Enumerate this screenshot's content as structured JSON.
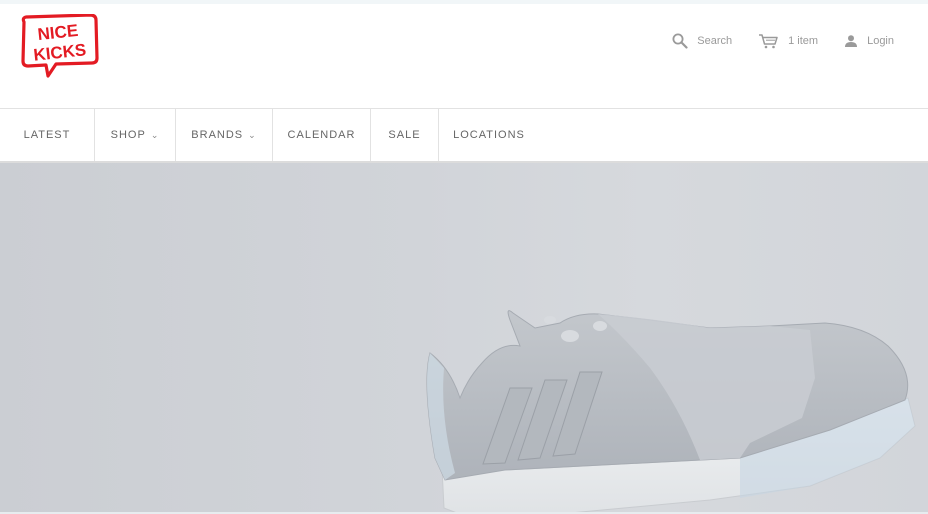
{
  "brand": {
    "logo_line1": "NICE",
    "logo_line2": "KICKS",
    "brand_color": "#e31b23"
  },
  "utility": {
    "search_label": "Search",
    "cart_label": "1 item",
    "login_label": "Login"
  },
  "nav": {
    "items": [
      {
        "label": "LATEST",
        "dropdown": false
      },
      {
        "label": "SHOP",
        "dropdown": true
      },
      {
        "label": "BRANDS",
        "dropdown": true
      },
      {
        "label": "CALENDAR",
        "dropdown": false
      },
      {
        "label": "SALE",
        "dropdown": false
      },
      {
        "label": "LOCATIONS",
        "dropdown": false
      }
    ]
  },
  "hero": {
    "image": "grey-sneaker-on-grey-background"
  }
}
